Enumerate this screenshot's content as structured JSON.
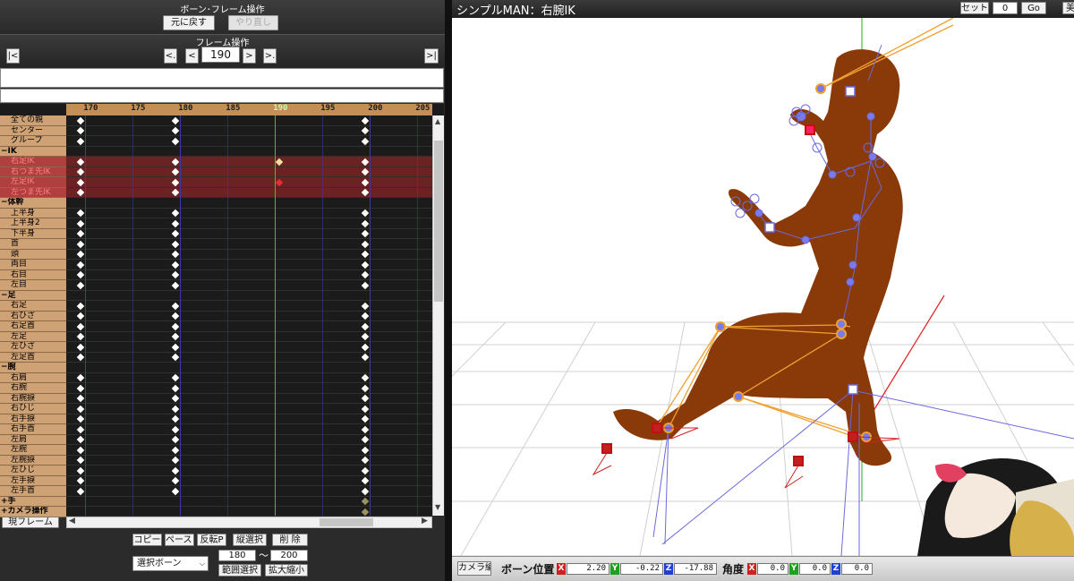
{
  "bone_panel": {
    "title": "ボーン･フレーム操作",
    "undo_label": "元に戻す",
    "redo_label": "やり直し"
  },
  "frame_panel": {
    "title": "フレーム操作",
    "first_label": "|<",
    "prev_key_label": "<.",
    "prev_label": "<",
    "frame_value": "190",
    "next_label": ">",
    "next_key_label": ">.",
    "last_label": ">|"
  },
  "timeline": {
    "ticks": [
      "170",
      "175",
      "180",
      "185",
      "190",
      "195",
      "200",
      "205"
    ],
    "current_frame": "190",
    "rows": [
      {
        "label": "全ての親",
        "type": "bone"
      },
      {
        "label": "センター",
        "type": "bone"
      },
      {
        "label": "グループ",
        "type": "bone"
      },
      {
        "label": "−IK",
        "type": "group"
      },
      {
        "label": "右足IK",
        "type": "ik"
      },
      {
        "label": "右つま先IK",
        "type": "ik"
      },
      {
        "label": "左足IK",
        "type": "ik"
      },
      {
        "label": "左つま先IK",
        "type": "ik"
      },
      {
        "label": "−体幹",
        "type": "group"
      },
      {
        "label": "上半身",
        "type": "bone"
      },
      {
        "label": "上半身2",
        "type": "bone"
      },
      {
        "label": "下半身",
        "type": "bone"
      },
      {
        "label": "首",
        "type": "bone"
      },
      {
        "label": "頭",
        "type": "bone"
      },
      {
        "label": "両目",
        "type": "bone"
      },
      {
        "label": "右目",
        "type": "bone"
      },
      {
        "label": "左目",
        "type": "bone"
      },
      {
        "label": "−足",
        "type": "group"
      },
      {
        "label": "右足",
        "type": "bone"
      },
      {
        "label": "右ひざ",
        "type": "bone"
      },
      {
        "label": "右足首",
        "type": "bone"
      },
      {
        "label": "左足",
        "type": "bone"
      },
      {
        "label": "左ひざ",
        "type": "bone"
      },
      {
        "label": "左足首",
        "type": "bone"
      },
      {
        "label": "−腕",
        "type": "group"
      },
      {
        "label": "右肩",
        "type": "bone"
      },
      {
        "label": "右腕",
        "type": "bone"
      },
      {
        "label": "右腕捩",
        "type": "bone"
      },
      {
        "label": "右ひじ",
        "type": "bone"
      },
      {
        "label": "右手捩",
        "type": "bone"
      },
      {
        "label": "右手首",
        "type": "bone"
      },
      {
        "label": "左肩",
        "type": "bone"
      },
      {
        "label": "左腕",
        "type": "bone"
      },
      {
        "label": "左腕捩",
        "type": "bone"
      },
      {
        "label": "左ひじ",
        "type": "bone"
      },
      {
        "label": "左手捩",
        "type": "bone"
      },
      {
        "label": "左手首",
        "type": "bone"
      },
      {
        "label": "+手",
        "type": "group"
      },
      {
        "label": "+カメラ操作",
        "type": "group"
      }
    ],
    "current_frame_button": "現フレーム"
  },
  "edit_panel": {
    "copy_label": "コピー",
    "paste_label": "ペースト",
    "flip_paste_label": "反転P",
    "vertical_select_label": "縦選択",
    "delete_label": "削 除",
    "select_bone_label": "選択ボーン",
    "range_from": "180",
    "range_sep": "〜",
    "range_to": "200",
    "range_select_label": "範囲選択",
    "scale_label": "拡大縮小"
  },
  "viewport": {
    "title": "シンプルMAN：右腕IK",
    "set_label": "セット",
    "set_value": "0",
    "go_label": "Go",
    "extra_label": "美",
    "camera_edit_label": "カメラ編",
    "bone_position_label": "ボーン位置",
    "pos_x": "2.20",
    "pos_y": "-0.22",
    "pos_z": "-17.88",
    "angle_label": "角度",
    "ang_x": "0.0",
    "ang_y": "0.0",
    "ang_z": "0.0",
    "axis_x": "X",
    "axis_y": "Y",
    "axis_z": "Z"
  },
  "colors": {
    "ruler": "#c48f57",
    "ik_row": "#6b2222",
    "current_frame_line": "#39c439",
    "model_skin": "#8a3a08",
    "bone_orange": "#f0a030",
    "bone_blue": "#6a6ae0"
  }
}
